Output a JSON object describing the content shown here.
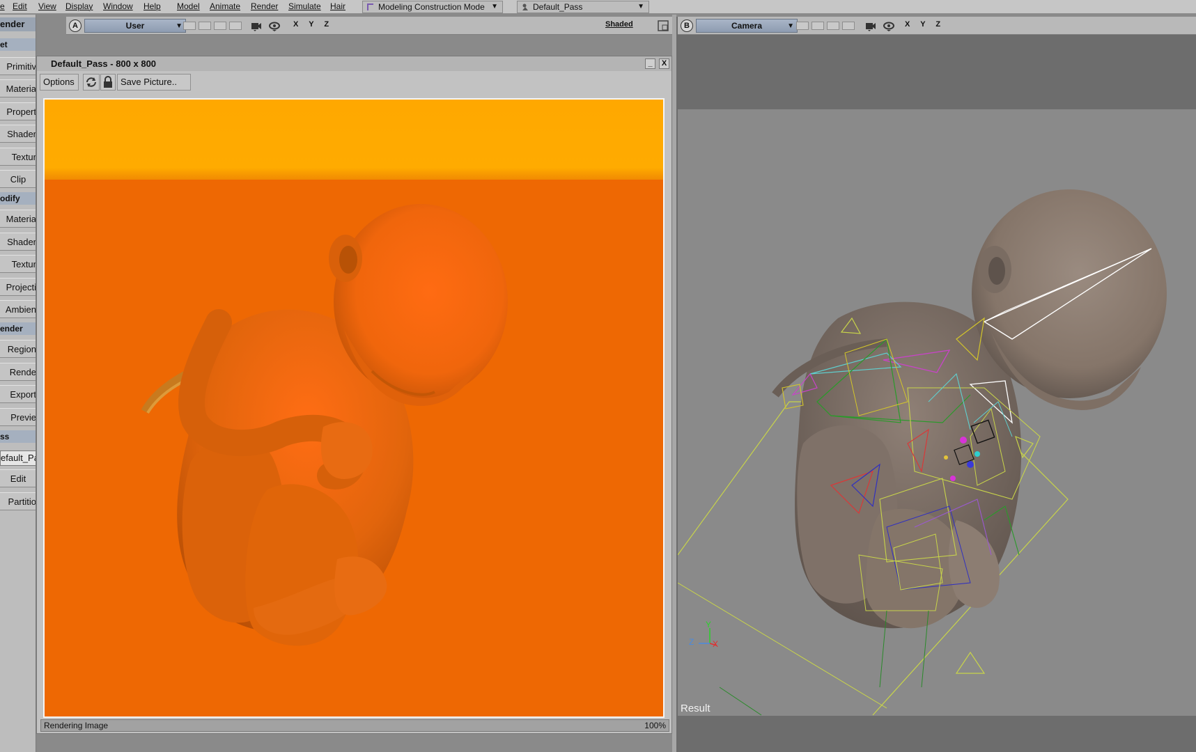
{
  "menubar": {
    "items": [
      "e",
      "Edit",
      "View",
      "Display",
      "Window",
      "Help",
      "Model",
      "Animate",
      "Render",
      "Simulate",
      "Hair"
    ],
    "construction_mode": "Modeling Construction Mode",
    "pass_selector": "Default_Pass"
  },
  "left_panel": {
    "header": "ender",
    "get_label": "et",
    "get_items": [
      "Primitiv",
      "Materia",
      "Propert",
      "Shader",
      "Textur",
      "Clip"
    ],
    "modify_label": "odify",
    "modify_items": [
      "Materia",
      "Shader",
      "Textur",
      "Projecti",
      "Ambien"
    ],
    "render_label": "ender",
    "render_items": [
      "Region",
      "Rende",
      "Export",
      "Previe"
    ],
    "pass_label": "ss",
    "pass_field": "efault_Pa",
    "pass_items": [
      "Edit",
      "Partitio"
    ]
  },
  "viewport_a": {
    "letter": "A",
    "camera": "User",
    "axes": "X Y Z",
    "display_mode": "Shaded"
  },
  "render_window": {
    "title": "Default_Pass -  800 x 800",
    "minimize": "_",
    "close": "X",
    "options_label": "Options",
    "save_picture_label": "Save Picture..",
    "status": "Rendering Image",
    "progress": "100%"
  },
  "viewport_b": {
    "letter": "B",
    "camera": "Camera",
    "axes": "X Y Z",
    "result_label": "Result",
    "gizmo_labels": {
      "y": "Y",
      "z": "Z",
      "x": "X"
    }
  },
  "colors": {
    "render_background": "#ee6803",
    "render_sky": "#ffab00",
    "figure_orange": "#e8680c",
    "viewport_grey": "#8a8a8a",
    "viewport_model": "#8b7c72",
    "camera_header_blue": "#9aa8bd"
  },
  "icons": [
    "refresh-icon",
    "lock-icon",
    "camera-icon",
    "eye-icon",
    "maximize-icon",
    "construction-mode-icon",
    "pass-icon"
  ]
}
